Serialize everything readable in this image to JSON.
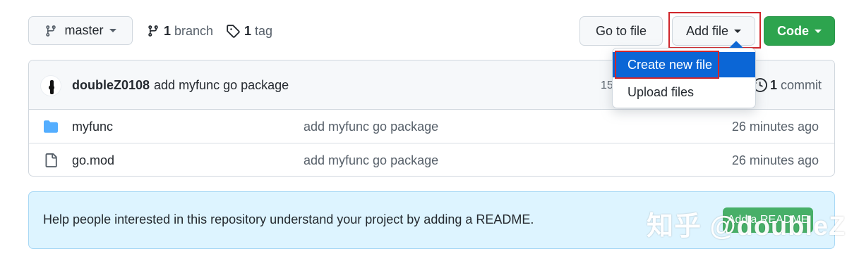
{
  "toolbar": {
    "branch_selector": {
      "label": "master"
    },
    "branches": {
      "count": "1",
      "label": "branch"
    },
    "tags": {
      "count": "1",
      "label": "tag"
    },
    "go_to_file": "Go to file",
    "add_file": "Add file",
    "code": "Code"
  },
  "add_file_menu": {
    "items": [
      {
        "label": "Create new file",
        "highlighted": true
      },
      {
        "label": "Upload files",
        "highlighted": false
      }
    ]
  },
  "latest_commit": {
    "author": "doubleZ0108",
    "message": "add myfunc go package",
    "hash_fragment": "15",
    "commits_count": "1",
    "commits_label": "commit"
  },
  "files": [
    {
      "icon": "folder-icon",
      "name": "myfunc",
      "message": "add myfunc go package",
      "time": "26 minutes ago"
    },
    {
      "icon": "file-icon",
      "name": "go.mod",
      "message": "add myfunc go package",
      "time": "26 minutes ago"
    }
  ],
  "readme_banner": {
    "text": "Help people interested in this repository understand your project by adding a README.",
    "button": "Add a README"
  },
  "watermark": "知乎 @doubleZ",
  "colors": {
    "accent_blue": "#0b66d6",
    "primary_green": "#2da44e",
    "folder_blue": "#54aeff",
    "highlight_red": "#d0262b",
    "banner_bg": "#ddf4ff"
  }
}
